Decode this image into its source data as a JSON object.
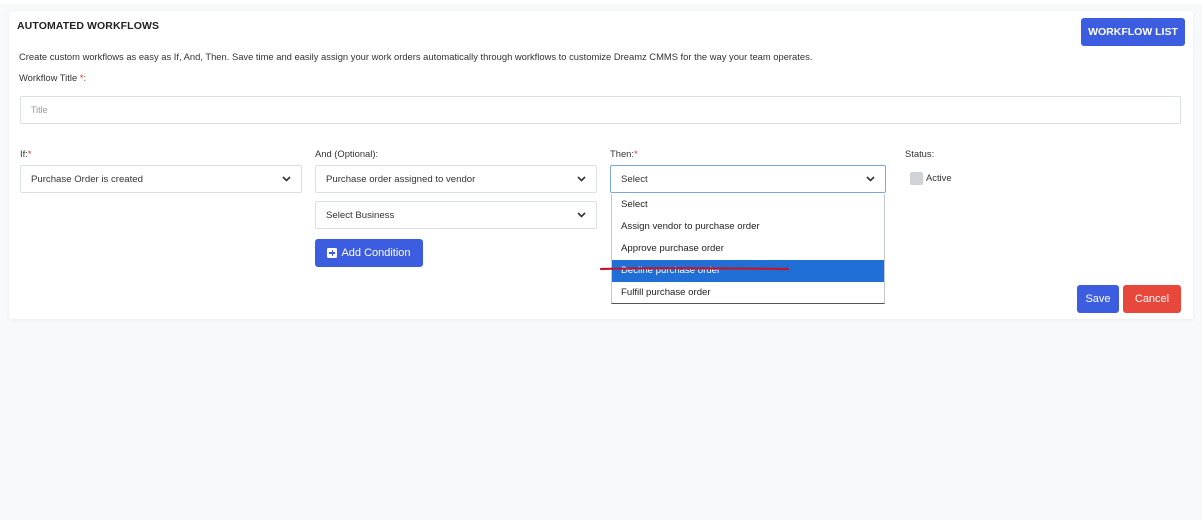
{
  "header": {
    "title": "AUTOMATED WORKFLOWS",
    "workflow_list_label": "WORKFLOW LIST"
  },
  "description": "Create custom workflows as easy as If, And, Then. Save time and easily assign your work orders automatically through workflows to customize Dreamz CMMS for the way your team operates.",
  "workflow_title": {
    "label": "Workflow Title",
    "required_mark": "*:",
    "placeholder": "Title",
    "value": ""
  },
  "if_field": {
    "label": "If:",
    "required_mark": "*",
    "selected": "Purchase Order is created"
  },
  "and_field": {
    "label": "And (Optional):",
    "selected": "Purchase order assigned to vendor",
    "business_selected": "Select Business",
    "add_condition_label": "Add Condition"
  },
  "then_field": {
    "label": "Then:",
    "required_mark": "*",
    "selected": "Select",
    "options": [
      "Select",
      "Assign vendor to purchase order",
      "Approve purchase order",
      "Decline purchase order",
      "Fulfill purchase order"
    ],
    "highlighted_option": "Decline purchase order"
  },
  "status": {
    "label": "Status:",
    "active_label": "Active",
    "active_checked": false
  },
  "actions": {
    "save_label": "Save",
    "cancel_label": "Cancel"
  },
  "colors": {
    "primary": "#3d5de0",
    "danger": "#e8473c",
    "highlight": "#1f6fd6",
    "required": "#e5322d",
    "annotation": "#c0182a"
  }
}
